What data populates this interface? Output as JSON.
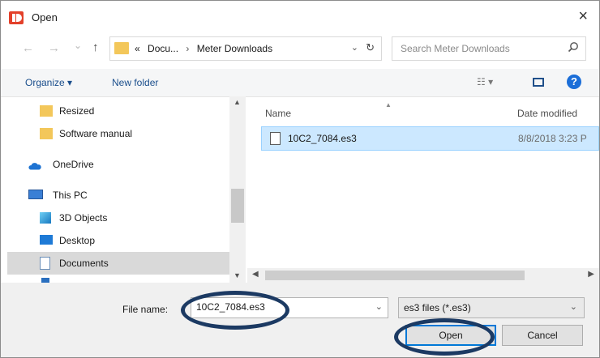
{
  "window": {
    "title": "Open",
    "close": "×"
  },
  "nav": {
    "back": "←",
    "forward": "→",
    "recent": "⌄",
    "up": "↑"
  },
  "address": {
    "overflow": "«",
    "crumbs": [
      "Docu...",
      "Meter Downloads"
    ],
    "separator": "›",
    "dropdown": "⌄",
    "refresh": "↻"
  },
  "search": {
    "placeholder": "Search Meter Downloads"
  },
  "toolbar": {
    "organize": "Organize ▾",
    "new_folder": "New folder",
    "views": "☷ ▾",
    "help": "?"
  },
  "sidebar": {
    "items": [
      {
        "label": "Resized",
        "icon": "folder-icon",
        "color": "#f3c75a"
      },
      {
        "label": "Software manual",
        "icon": "folder-icon",
        "color": "#f3c75a"
      },
      {
        "label": "OneDrive",
        "icon": "cloud-icon",
        "color": "#1e73d2"
      },
      {
        "label": "This PC",
        "icon": "monitor-icon",
        "color": "#3a7fd5"
      },
      {
        "label": "3D Objects",
        "icon": "cube-icon",
        "color": "#2aa0d8"
      },
      {
        "label": "Desktop",
        "icon": "desktop-icon",
        "color": "#1e7ad6"
      },
      {
        "label": "Documents",
        "icon": "document-icon",
        "color": "#6a8fb8"
      }
    ],
    "selected": "Documents"
  },
  "files": {
    "columns": {
      "name": "Name",
      "date": "Date modified"
    },
    "rows": [
      {
        "name": "10C2_7084.es3",
        "date": "8/8/2018 3:23 P"
      }
    ]
  },
  "bottom": {
    "file_name_label": "File name:",
    "file_name_value": "10C2_7084.es3",
    "file_type": "es3 files (*.es3)",
    "open": "Open",
    "cancel": "Cancel"
  },
  "colors": {
    "annotation_circle": "#1c3a63",
    "selection": "#cce8ff",
    "link": "#1a4e8c"
  }
}
